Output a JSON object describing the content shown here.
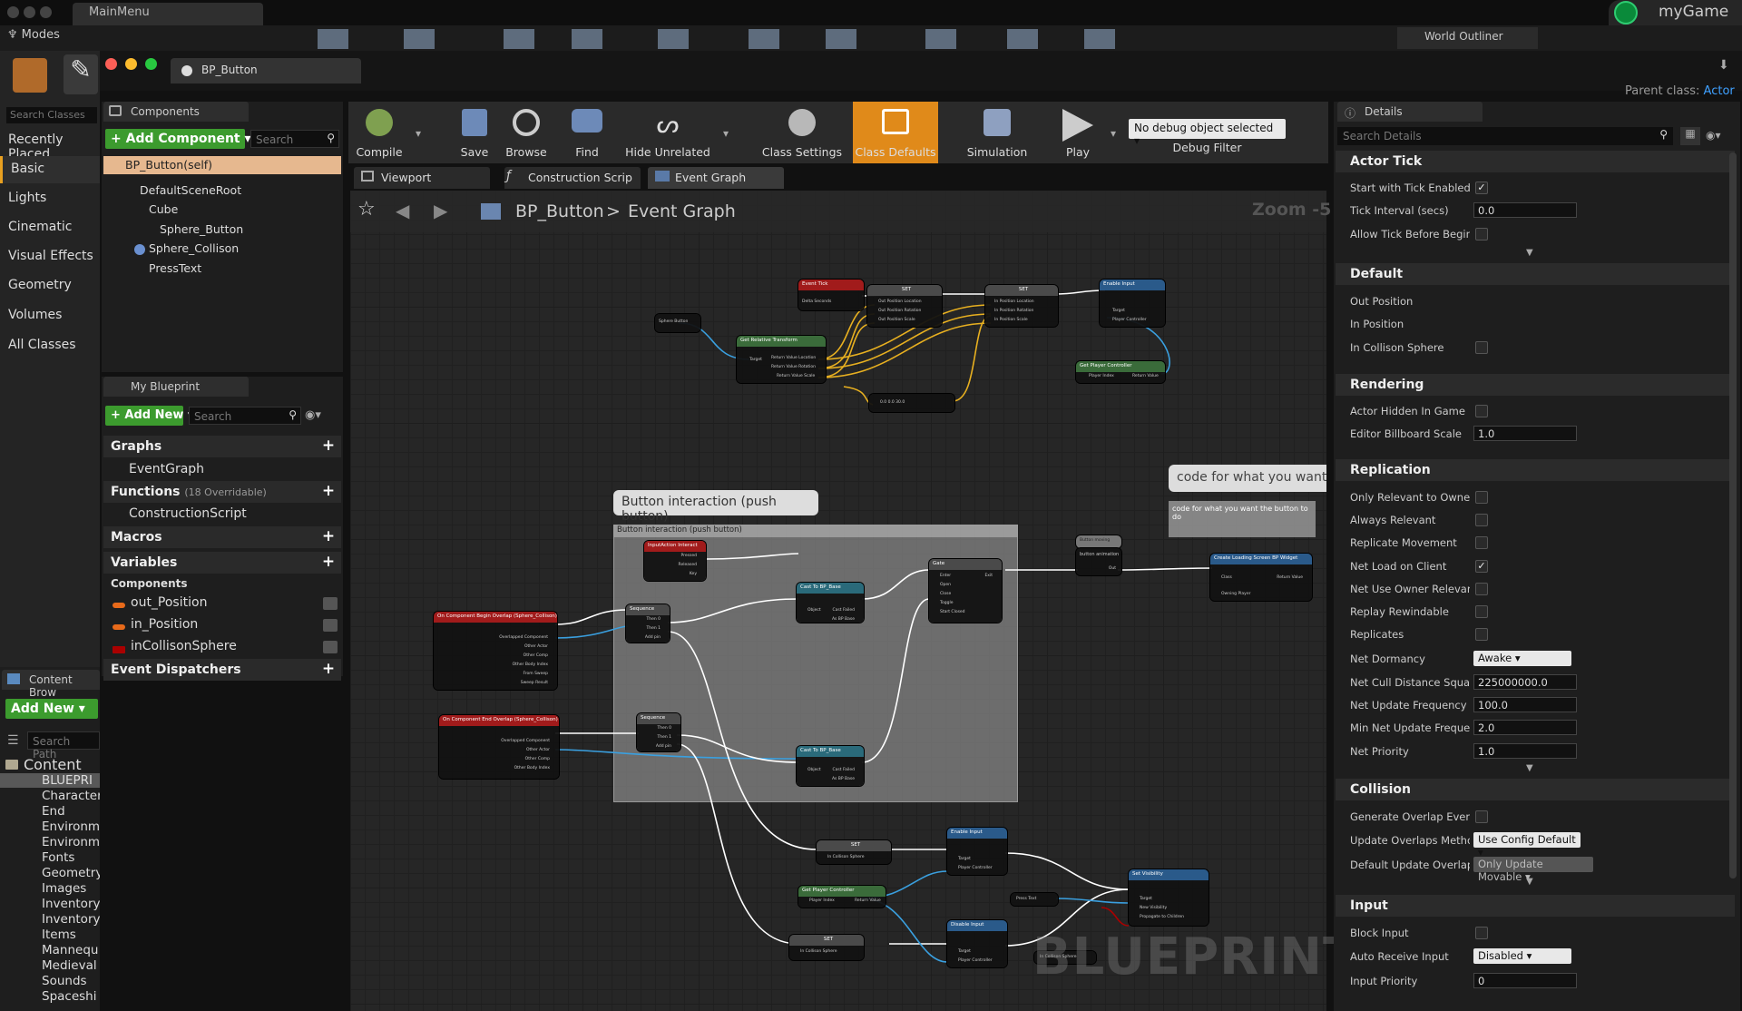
{
  "window": {
    "main_tab": "MainMenu",
    "game_name": "myGame",
    "modes_label": "Modes",
    "world_outliner": "World Outliner",
    "bp_tab": "BP_Button",
    "parent_class_label": "Parent class:",
    "parent_class_value": "Actor"
  },
  "modes": {
    "search_placeholder": "Search Classes",
    "categories": [
      "Recently Placed",
      "Basic",
      "Lights",
      "Cinematic",
      "Visual Effects",
      "Geometry",
      "Volumes",
      "All Classes"
    ]
  },
  "components": {
    "title": "Components",
    "add_button": "+ Add Component ▾",
    "search_placeholder": "Search",
    "selected": "BP_Button(self)",
    "tree": [
      "DefaultSceneRoot",
      "Cube",
      "Sphere_Button",
      "Sphere_Collison",
      "PressText"
    ]
  },
  "my_blueprint": {
    "title": "My Blueprint",
    "add_new": "+ Add New ▾",
    "search_placeholder": "Search",
    "graphs": "Graphs",
    "event_graph": "EventGraph",
    "functions": "Functions",
    "functions_count": "(18 Overridable)",
    "construction_script": "ConstructionScript",
    "macros": "Macros",
    "variables": "Variables",
    "components_cat": "Components",
    "vars": [
      "out_Position",
      "in_Position",
      "inCollisonSphere"
    ],
    "event_dispatchers": "Event Dispatchers"
  },
  "content_browser": {
    "title": "Content Brow",
    "add_new": "Add New ▾",
    "search_placeholder": "Search Path",
    "root": "Content",
    "items": [
      "BLUEPRI",
      "Character",
      "End",
      "Environm",
      "Environm",
      "Fonts",
      "Geometry",
      "Images",
      "Inventory",
      "Inventory",
      "Items",
      "Mannequ",
      "Medieval",
      "Sounds",
      "Spaceshi"
    ]
  },
  "toolbar": {
    "buttons": [
      "Compile",
      "Save",
      "Browse",
      "Find",
      "Hide Unrelated",
      "Class Settings",
      "Class Defaults",
      "Simulation",
      "Play"
    ],
    "debug_select": "No debug object selected ▾",
    "debug_filter": "Debug Filter"
  },
  "graph_tabs": [
    "Viewport",
    "Construction Scrip",
    "Event Graph"
  ],
  "breadcrumb": {
    "root": "BP_Button",
    "sep": ">",
    "graph": "Event Graph",
    "zoom": "Zoom -5"
  },
  "graph": {
    "comment_bubble": "Button interaction (push button)",
    "comment_title": "Button interaction (push button)",
    "bubble2": "code for what you want th",
    "bubble2_body": "code for what you want the button to do",
    "watermark": "BLUEPRINT",
    "nodes": {
      "event_tick": "Event Tick",
      "delta": "Delta Seconds",
      "set": "SET",
      "out_pos_loc": "Out Position Location",
      "out_pos_rot": "Out Position Rotation",
      "out_pos_scale": "Out Position Scale",
      "in_pos_loc": "In Position Location",
      "in_pos_rot": "In Position Rotation",
      "in_pos_scale": "In Position Scale",
      "enable_input": "Enable Input",
      "target_actor": "Target is Actor",
      "target": "Target",
      "player_controller": "Player Controller",
      "sphere_button": "Sphere Button",
      "get_rel_transform": "Get Relative Transform",
      "target_scene": "Target is Scene Component",
      "ret_loc": "Return Value Location",
      "ret_rot": "Return Value Rotation",
      "ret_scale": "Return Value Scale",
      "get_player_controller": "Get Player Controller",
      "player_index": "Player Index",
      "return_value": "Return Value",
      "vec": "0.0  0.0  30.0",
      "input_action": "InputAction Interact",
      "pressed": "Pressed",
      "released": "Released",
      "key": "Key",
      "sequence": "Sequence",
      "then0": "Then 0",
      "then1": "Then 1",
      "add_pin": "Add pin",
      "cast_bp": "Cast To BP_Base",
      "object": "Object",
      "cast_failed": "Cast Failed",
      "as_bp": "As BP Base",
      "flipflop": "Gate",
      "enter": "Enter",
      "open": "Open",
      "close": "Close",
      "toggle": "Toggle",
      "start_closed": "Start Closed",
      "exit": "Exit",
      "begin_overlap": "On Component Begin Overlap (Sphere_Collison)",
      "end_overlap": "On Component End Overlap (Sphere_Collison)",
      "overlapped": "Overlapped Component",
      "other_actor": "Other Actor",
      "other_comp": "Other Comp",
      "other_body": "Other Body Index",
      "from_sweep": "From Sweep",
      "sweep_result": "Sweep Result",
      "button_moving": "Button moving",
      "button_anim": "button animation",
      "create_widget": "Create Loading Screen BP Widget",
      "class": "Class",
      "owning_player": "Owning Player",
      "in_collision": "In Collison Sphere",
      "disable_input": "Disable Input",
      "set_visibility": "Set Visibility",
      "new_visibility": "New Visibility",
      "propagate": "Propagate to Children",
      "press_text": "Press Text",
      "out": "Out"
    }
  },
  "details": {
    "title": "Details",
    "search_placeholder": "Search Details",
    "actor_tick": "Actor Tick",
    "start_tick": "Start with Tick Enabled",
    "tick_interval": "Tick Interval (secs)",
    "tick_interval_val": "0.0",
    "allow_tick": "Allow Tick Before Begin Pl",
    "default": "Default",
    "out_position": "Out Position",
    "in_position": "In Position",
    "in_collison_sphere": "In Collison Sphere",
    "rendering": "Rendering",
    "actor_hidden": "Actor Hidden In Game",
    "billboard_scale": "Editor Billboard Scale",
    "billboard_val": "1.0",
    "replication": "Replication",
    "only_relevant": "Only Relevant to Owner",
    "always_relevant": "Always Relevant",
    "replicate_movement": "Replicate Movement",
    "net_load": "Net Load on Client",
    "net_use_owner": "Net Use Owner Relevancy",
    "replay_rewind": "Replay Rewindable",
    "replicates": "Replicates",
    "net_dormancy": "Net Dormancy",
    "net_dormancy_val": "Awake ▾",
    "net_cull": "Net Cull Distance Squared",
    "net_cull_val": "225000000.0",
    "net_update": "Net Update Frequency",
    "net_update_val": "100.0",
    "min_net_update": "Min Net Update Frequency",
    "min_net_update_val": "2.0",
    "net_priority": "Net Priority",
    "net_priority_val": "1.0",
    "collision": "Collision",
    "gen_overlap": "Generate Overlap Events D",
    "update_overlaps": "Update Overlaps Method D",
    "update_overlaps_val": "Use Config Default ▾",
    "default_update": "Default Update Overlaps M",
    "default_update_val": "Only Update Movable ▾",
    "input": "Input",
    "block_input": "Block Input",
    "auto_receive": "Auto Receive Input",
    "auto_receive_val": "Disabled ▾",
    "input_priority": "Input Priority",
    "input_priority_val": "0"
  },
  "colors": {
    "accent": "#3c9b2e",
    "class_defaults": "#e08a1a",
    "event_red": "#a11b1b",
    "func_green": "#3a6b3a",
    "func_blue": "#2a5a8a",
    "sequence_grey": "#4a4a4a",
    "wire_white": "#ffffff",
    "wire_blue": "#3aa0e0",
    "wire_yellow": "#e8b020"
  }
}
